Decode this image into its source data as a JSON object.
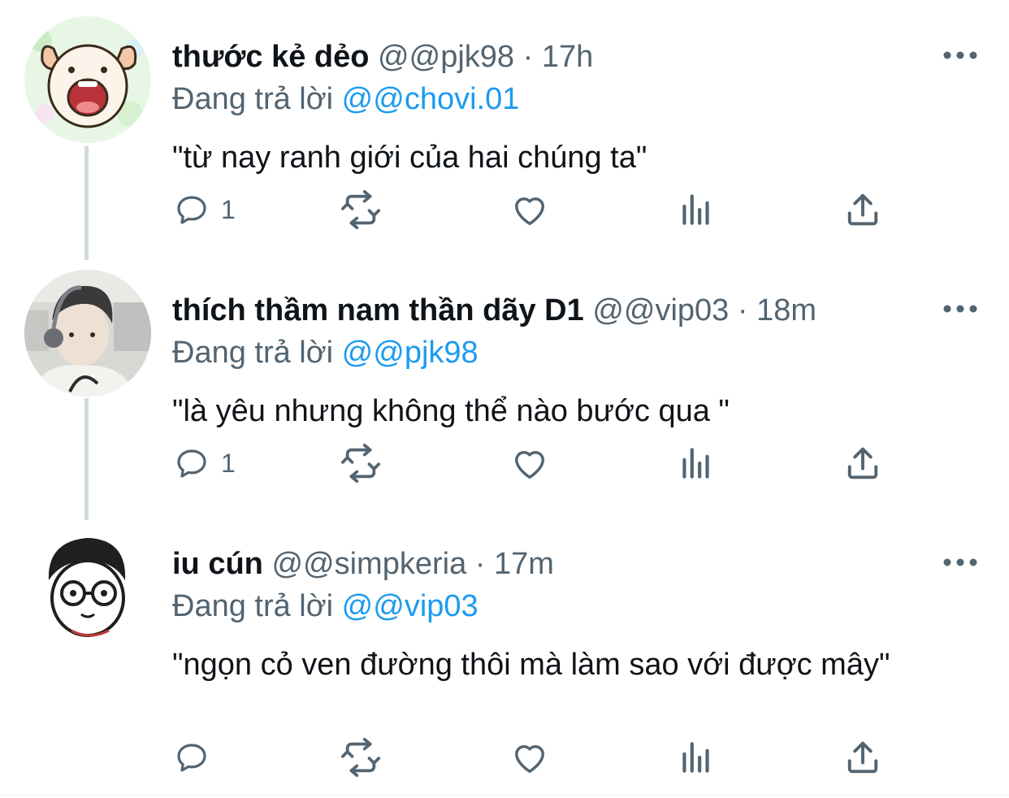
{
  "tweets": [
    {
      "name": "thước kẻ dẻo",
      "handle": "@@pjk98",
      "dot": "·",
      "time": "17h",
      "reply_prefix": "Đang trả lời",
      "reply_mention": "@@chovi.01",
      "text": "\"từ nay ranh giới của hai chúng ta\"",
      "reply_count": "1"
    },
    {
      "name": "thích thầm nam thần dãy D1",
      "handle": "@@vip03",
      "dot": "·",
      "time": "18m",
      "reply_prefix": "Đang trả lời",
      "reply_mention": "@@pjk98",
      "text": "\"là yêu nhưng không thể nào bước qua \"",
      "reply_count": "1"
    },
    {
      "name": "iu cún",
      "handle": "@@simpkeria",
      "dot": "·",
      "time": "17m",
      "reply_prefix": "Đang trả lời",
      "reply_mention": "@@vip03",
      "text": "\"ngọn cỏ ven đường thôi mà làm sao với được mây\"",
      "reply_count": ""
    }
  ],
  "colors": {
    "text": "#0f1419",
    "secondary": "#536471",
    "link": "#1d9bf0",
    "thread_line": "#cfd9de"
  },
  "icons": [
    "reply-icon",
    "retweet-icon",
    "like-icon",
    "analytics-icon",
    "share-icon",
    "more-icon"
  ]
}
